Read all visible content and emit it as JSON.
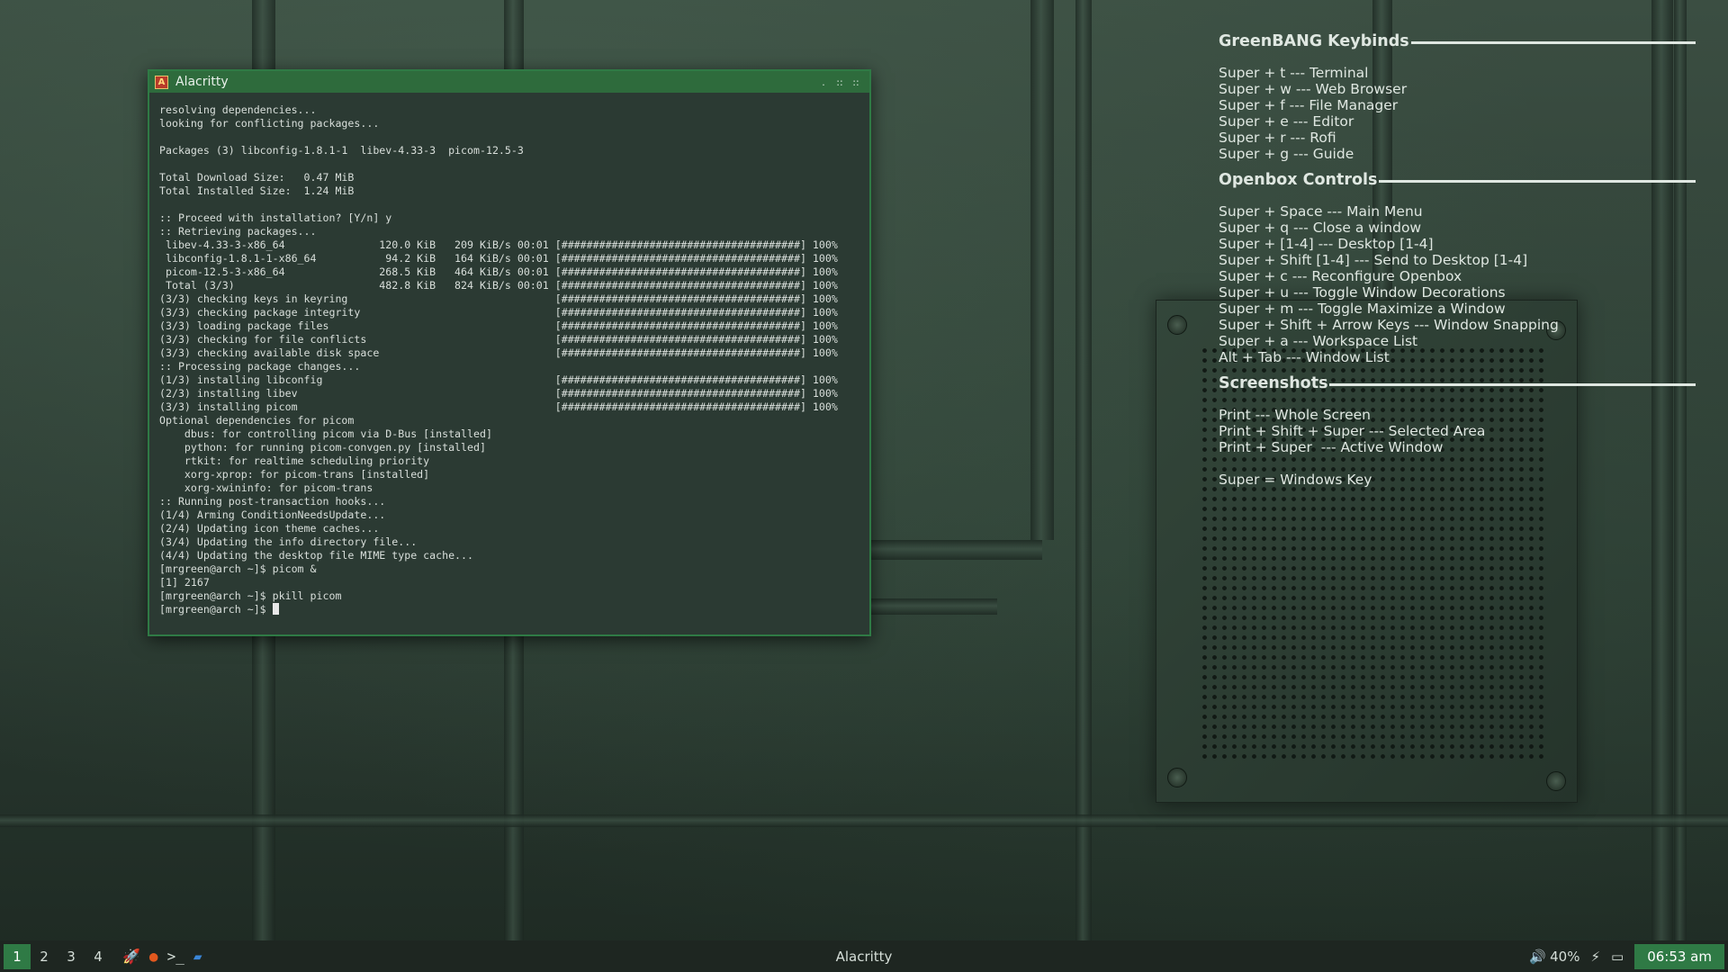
{
  "window": {
    "title": "Alacritty",
    "icon_glyph": "A",
    "buttons": {
      "iconify": ".",
      "maximize": "::",
      "close": "::"
    }
  },
  "terminal": {
    "lines": [
      "resolving dependencies...",
      "looking for conflicting packages...",
      "",
      "Packages (3) libconfig-1.8.1-1  libev-4.33-3  picom-12.5-3",
      "",
      "Total Download Size:   0.47 MiB",
      "Total Installed Size:  1.24 MiB",
      "",
      ":: Proceed with installation? [Y/n] y",
      ":: Retrieving packages...",
      " libev-4.33-3-x86_64               120.0 KiB   209 KiB/s 00:01 [######################################] 100%",
      " libconfig-1.8.1-1-x86_64           94.2 KiB   164 KiB/s 00:01 [######################################] 100%",
      " picom-12.5-3-x86_64               268.5 KiB   464 KiB/s 00:01 [######################################] 100%",
      " Total (3/3)                       482.8 KiB   824 KiB/s 00:01 [######################################] 100%",
      "(3/3) checking keys in keyring                                 [######################################] 100%",
      "(3/3) checking package integrity                               [######################################] 100%",
      "(3/3) loading package files                                    [######################################] 100%",
      "(3/3) checking for file conflicts                              [######################################] 100%",
      "(3/3) checking available disk space                            [######################################] 100%",
      ":: Processing package changes...",
      "(1/3) installing libconfig                                     [######################################] 100%",
      "(2/3) installing libev                                         [######################################] 100%",
      "(3/3) installing picom                                         [######################################] 100%",
      "Optional dependencies for picom",
      "    dbus: for controlling picom via D-Bus [installed]",
      "    python: for running picom-convgen.py [installed]",
      "    rtkit: for realtime scheduling priority",
      "    xorg-xprop: for picom-trans [installed]",
      "    xorg-xwininfo: for picom-trans",
      ":: Running post-transaction hooks...",
      "(1/4) Arming ConditionNeedsUpdate...",
      "(2/4) Updating icon theme caches...",
      "(3/4) Updating the info directory file...",
      "(4/4) Updating the desktop file MIME type cache...",
      "[mrgreen@arch ~]$ picom &",
      "[1] 2167",
      "[mrgreen@arch ~]$ pkill picom"
    ],
    "prompt": "[mrgreen@arch ~]$ "
  },
  "conky": {
    "sections": [
      {
        "title": "GreenBANG Keybinds",
        "lines": [
          "Super + t --- Terminal",
          "Super + w --- Web Browser",
          "Super + f --- File Manager",
          "Super + e --- Editor",
          "Super + r --- Rofi",
          "Super + g --- Guide"
        ]
      },
      {
        "title": "Openbox Controls",
        "lines": [
          "Super + Space --- Main Menu",
          "Super + q --- Close a window",
          "Super + [1-4] --- Desktop [1-4]",
          "Super + Shift [1-4] --- Send to Desktop [1-4]",
          "Super + c --- Reconfigure Openbox",
          "Super + u --- Toggle Window Decorations",
          "Super + m --- Toggle Maximize a Window",
          "Super + Shift + Arrow Keys --- Window Snapping",
          "Super + a --- Workspace List",
          "Alt + Tab --- Window List"
        ]
      },
      {
        "title": "Screenshots",
        "lines": [
          "Print --- Whole Screen",
          "Print + Shift + Super --- Selected Area",
          "Print + Super  --- Active Window"
        ],
        "footer": "Super = Windows Key"
      }
    ]
  },
  "taskbar": {
    "workspaces": [
      "1",
      "2",
      "3",
      "4"
    ],
    "active_workspace": "1",
    "launchers": [
      {
        "name": "rocket-launcher-icon",
        "glyph": "🚀"
      },
      {
        "name": "firefox-icon",
        "glyph": "●"
      },
      {
        "name": "terminal-icon",
        "glyph": ">_"
      },
      {
        "name": "folder-icon",
        "glyph": "▰"
      }
    ],
    "active_window_title": "Alacritty",
    "volume": "40%",
    "volume_glyph": "🔊",
    "power_glyph": "⚡",
    "display_glyph": "▭",
    "clock": "06:53 am"
  },
  "colors": {
    "accent": "#2f7a45",
    "titlebar": "#2e6b3c",
    "terminal_bg": "#2b3a33"
  }
}
